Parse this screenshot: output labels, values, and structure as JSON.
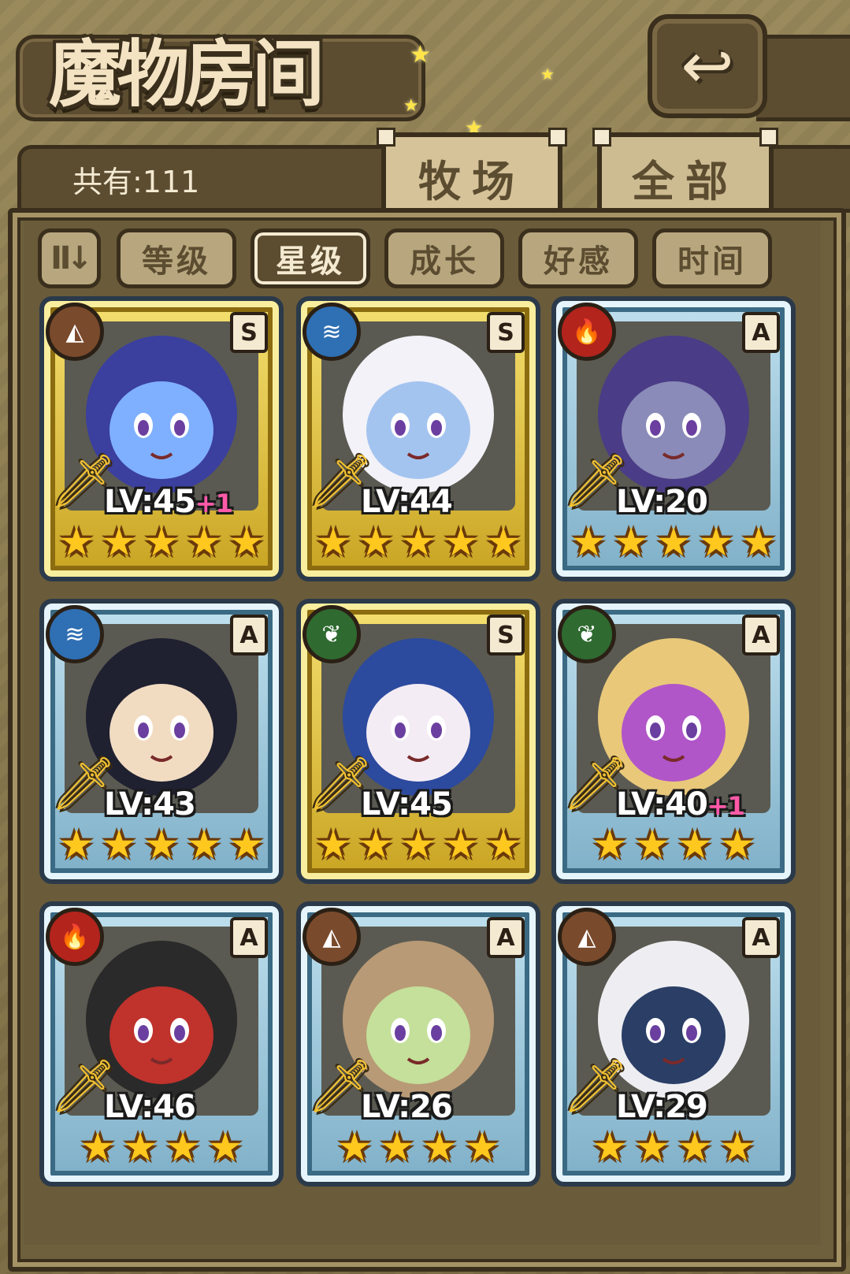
{
  "page": {
    "title": "魔物房间",
    "back_icon": "back-arrow-icon"
  },
  "header": {
    "count_label": "共有:111"
  },
  "tabs": [
    {
      "label": "牧场",
      "selected": true
    },
    {
      "label": "全部",
      "selected": false
    }
  ],
  "sort": {
    "toggle_icon": "sort-order-icon",
    "options": [
      {
        "label": "等级",
        "active": false
      },
      {
        "label": "星级",
        "active": true
      },
      {
        "label": "成长",
        "active": false
      },
      {
        "label": "好感",
        "active": false
      },
      {
        "label": "时间",
        "active": false
      }
    ]
  },
  "cards": [
    {
      "element": "earth-icon",
      "rank": "S",
      "level": "LV:45",
      "bonus": "+1",
      "stars": 5,
      "tier": "S",
      "colors": [
        "#3b3f9e",
        "#7fb0ff"
      ]
    },
    {
      "element": "water-icon",
      "rank": "S",
      "level": "LV:44",
      "bonus": "",
      "stars": 5,
      "tier": "S",
      "colors": [
        "#f2f2f8",
        "#a4c4f0"
      ]
    },
    {
      "element": "fire-icon",
      "rank": "A",
      "level": "LV:20",
      "bonus": "",
      "stars": 5,
      "tier": "A",
      "colors": [
        "#4a3c86",
        "#8a8bb8"
      ]
    },
    {
      "element": "water-icon",
      "rank": "A",
      "level": "LV:43",
      "bonus": "",
      "stars": 5,
      "tier": "A",
      "colors": [
        "#1f2030",
        "#f1dcc2"
      ]
    },
    {
      "element": "wood-icon",
      "rank": "S",
      "level": "LV:45",
      "bonus": "",
      "stars": 5,
      "tier": "S",
      "colors": [
        "#2c4a9e",
        "#f4ecf4"
      ]
    },
    {
      "element": "wood-icon",
      "rank": "A",
      "level": "LV:40",
      "bonus": "+1",
      "stars": 4,
      "tier": "A",
      "colors": [
        "#e9c87a",
        "#b056c8"
      ]
    },
    {
      "element": "fire-icon",
      "rank": "A",
      "level": "LV:46",
      "bonus": "",
      "stars": 4,
      "tier": "A",
      "colors": [
        "#2a2a2a",
        "#c0322c"
      ]
    },
    {
      "element": "earth-icon",
      "rank": "A",
      "level": "LV:26",
      "bonus": "",
      "stars": 4,
      "tier": "A",
      "colors": [
        "#b89a76",
        "#c4e09a"
      ]
    },
    {
      "element": "earth-icon",
      "rank": "A",
      "level": "LV:29",
      "bonus": "",
      "stars": 4,
      "tier": "A",
      "colors": [
        "#eeeef2",
        "#2a3e66"
      ]
    }
  ]
}
